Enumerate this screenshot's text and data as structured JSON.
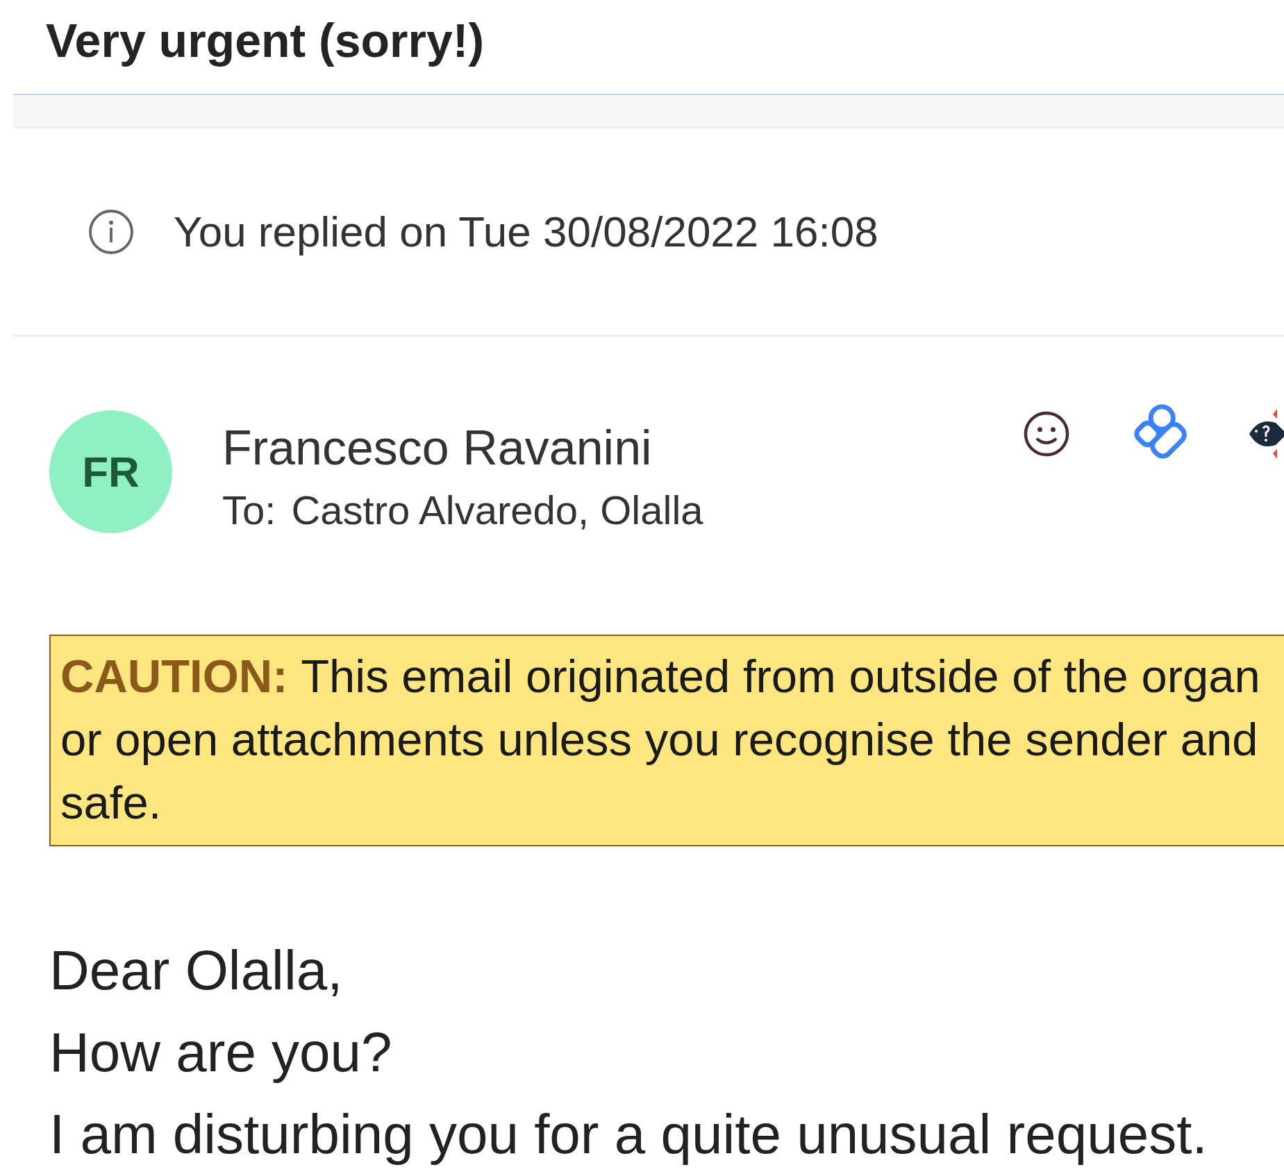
{
  "subject": "Very urgent (sorry!)",
  "info": {
    "text": "You replied on Tue 30/08/2022 16:08"
  },
  "sender": {
    "initials": "FR",
    "name": "Francesco Ravanini",
    "to_label": "To:",
    "to": "Castro Alvaredo, Olalla"
  },
  "caution": {
    "label": "CAUTION:",
    "lines": [
      "This email originated from outside of the organ",
      "or open attachments unless you recognise the sender and",
      "safe."
    ]
  },
  "body": [
    "Dear Olalla,",
    "How are you?",
    "I am disturbing you for a quite unusual request."
  ]
}
